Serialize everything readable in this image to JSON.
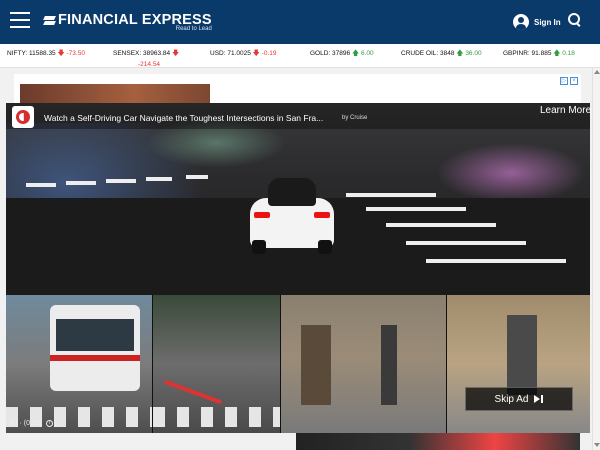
{
  "header": {
    "logo_text": "FINANCIAL EXPRESS",
    "logo_tagline": "Read to Lead",
    "signin_label": "Sign In",
    "icons": [
      "hamburger-menu-icon",
      "user-icon",
      "search-icon"
    ],
    "bg_color": "#0a3a6a"
  },
  "ticker": {
    "items": [
      {
        "label": "NIFTY:",
        "value": "11588.35",
        "direction": "down",
        "change": "-73.50"
      },
      {
        "label": "SENSEX:",
        "value": "38963.84",
        "direction": "down",
        "change": "-214.54"
      },
      {
        "label": "USD:",
        "value": "71.0025",
        "direction": "down",
        "change": "-0.19"
      },
      {
        "label": "GOLD:",
        "value": "37896",
        "direction": "up",
        "change": "6.00"
      },
      {
        "label": "CRUDE OIL:",
        "value": "3848",
        "direction": "up",
        "change": "36.00"
      },
      {
        "label": "GBPINR:",
        "value": "91.885",
        "direction": "up",
        "change": "0.18"
      }
    ],
    "down_color": "#e53935",
    "up_color": "#2e9e42"
  },
  "video_ad": {
    "title": "Watch a Self-Driving Car Navigate the Toughest Intersections in San Fra...",
    "brand": "by Cruise",
    "learn_more": "Learn More",
    "skip_label": "Skip Ad",
    "timer": "Ad · (0:21)"
  }
}
